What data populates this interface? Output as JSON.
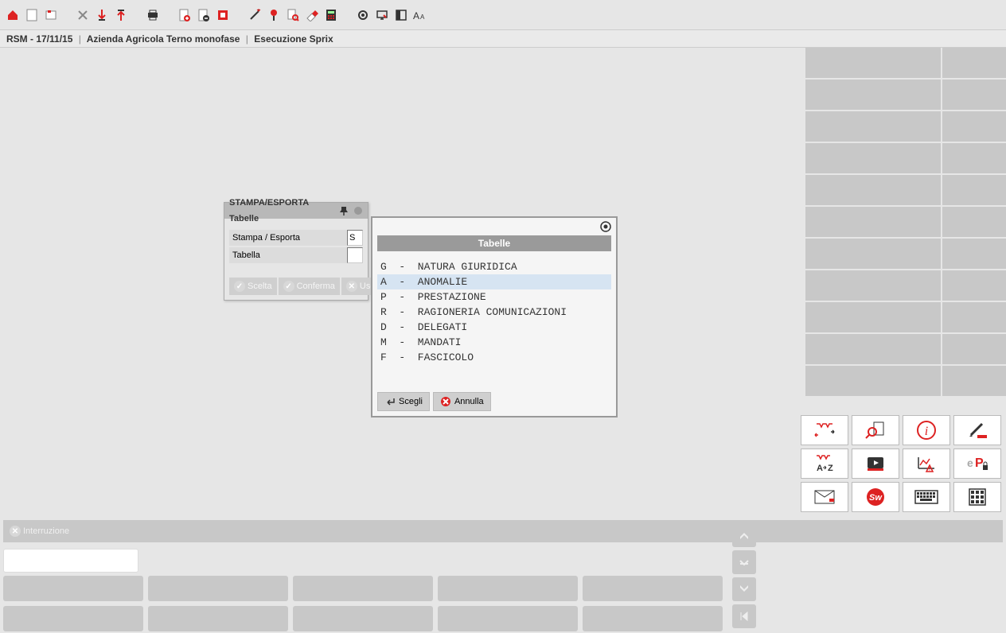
{
  "breadcrumb": {
    "app": "RSM - 17/11/15",
    "company": "Azienda Agricola Terno monofase",
    "context": "Esecuzione Sprix"
  },
  "toolbar_icons": [
    "home-icon",
    "blank-icon",
    "new-tab-icon",
    "tools-icon",
    "flag-down-icon",
    "flag-up-icon",
    "printer-icon",
    "doc-add-icon",
    "doc-remove-icon",
    "red-box-icon",
    "wand-icon",
    "pin-icon",
    "search-doc-icon",
    "eraser-icon",
    "calculator-icon",
    "record-icon",
    "monitor-icon",
    "panel-icon",
    "font-size-icon"
  ],
  "win1": {
    "title": "STAMPA/ESPORTA Tabelle",
    "fields": {
      "f1_label": "Stampa / Esporta",
      "f1_value": "S",
      "f2_label": "Tabella",
      "f2_value": ""
    },
    "buttons": {
      "scelta": "Scelta",
      "conferma": "Conferma",
      "uscita": "Uscita"
    }
  },
  "popup": {
    "title": "Tabelle",
    "items": [
      {
        "code": "G",
        "label": "NATURA GIURIDICA",
        "selected": false
      },
      {
        "code": "A",
        "label": "ANOMALIE",
        "selected": true
      },
      {
        "code": "P",
        "label": "PRESTAZIONE",
        "selected": false
      },
      {
        "code": "R",
        "label": "RAGIONERIA COMUNICAZIONI",
        "selected": false
      },
      {
        "code": "D",
        "label": "DELEGATI",
        "selected": false
      },
      {
        "code": "M",
        "label": "MANDATI",
        "selected": false
      },
      {
        "code": "F",
        "label": "FASCICOLO",
        "selected": false
      }
    ],
    "buttons": {
      "scegli": "Scegli",
      "annulla": "Annulla"
    }
  },
  "status": {
    "interruzione": "Interruzione"
  },
  "right_icons": [
    "factory-cycle-icon",
    "zoom-doc-icon",
    "info-icon",
    "pen-icon",
    "factory-az-icon",
    "video-icon",
    "chart-warn-icon",
    "ep-lock-icon",
    "mail-icon",
    "sw-icon",
    "keyboard-icon",
    "numpad-icon"
  ],
  "nav_icons": [
    "up-icon",
    "drawer-icon",
    "down-icon",
    "first-icon"
  ]
}
